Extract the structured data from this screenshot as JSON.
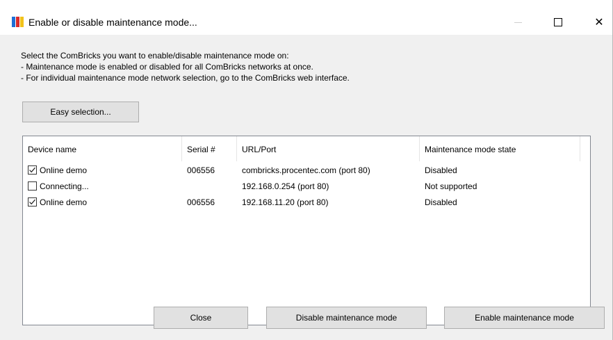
{
  "window": {
    "title": "Enable or disable maintenance mode...",
    "icon": "combricks-app-icon",
    "controls": {
      "minimize": "minimize-icon",
      "maximize": "maximize-icon",
      "close": "close-icon"
    },
    "close_glyph": "✕"
  },
  "instructions": {
    "line1": "Select the ComBricks you want to enable/disable maintenance mode on:",
    "line2": "- Maintenance mode is enabled or disabled for all ComBricks networks at once.",
    "line3": "- For individual maintenance mode network selection, go to the ComBricks web interface."
  },
  "easy_selection_label": "Easy selection...",
  "list": {
    "columns": [
      "Device name",
      "Serial #",
      "URL/Port",
      "Maintenance mode state"
    ],
    "rows": [
      {
        "checked": true,
        "device": "Online demo",
        "serial": "006556",
        "url": "combricks.procentec.com (port 80)",
        "state": "Disabled"
      },
      {
        "checked": false,
        "device": "Connecting...",
        "serial": "",
        "url": "192.168.0.254 (port 80)",
        "state": "Not supported"
      },
      {
        "checked": true,
        "device": "Online demo",
        "serial": "006556",
        "url": "192.168.11.20 (port 80)",
        "state": "Disabled"
      }
    ]
  },
  "buttons": {
    "close": "Close",
    "disable": "Disable maintenance mode",
    "enable": "Enable maintenance mode"
  },
  "colors": {
    "dialog_bg": "#f0f0f0",
    "button_bg": "#e1e1e1",
    "button_border": "#adadad",
    "list_border": "#828790"
  }
}
